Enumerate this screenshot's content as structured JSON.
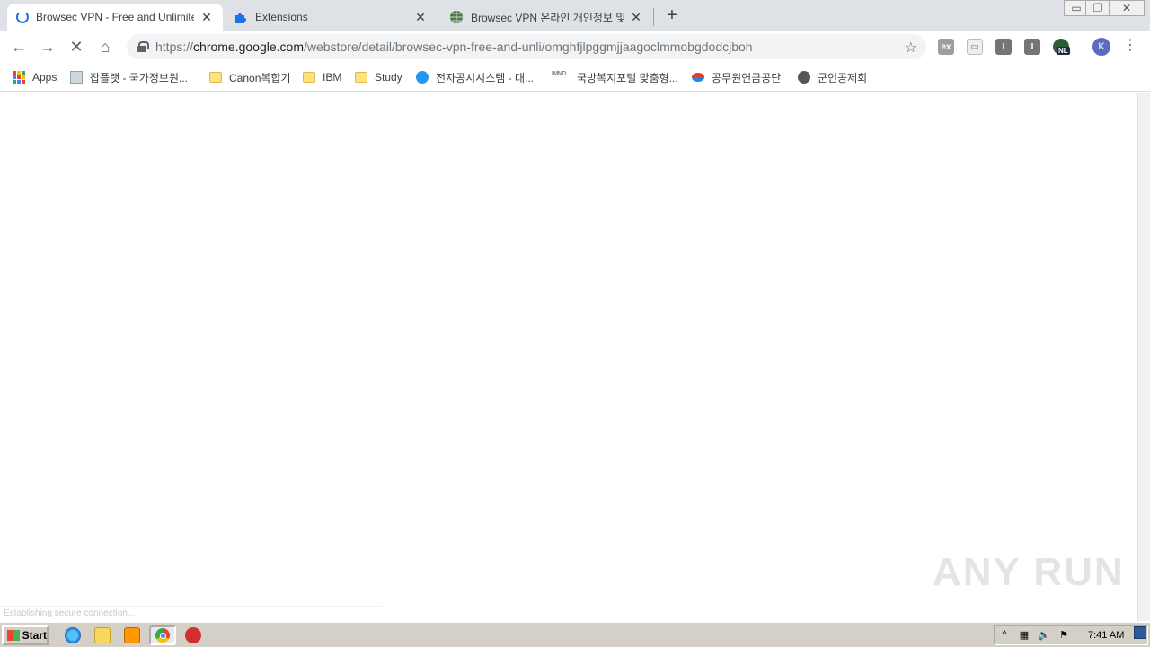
{
  "tabs": [
    {
      "title": "Browsec VPN - Free and Unlimited VPN",
      "active": true,
      "icon": "loading-spinner"
    },
    {
      "title": "Extensions",
      "active": false,
      "icon": "puzzle-icon"
    },
    {
      "title": "Browsec VPN 온라인 개인정보 및 보안",
      "active": false,
      "icon": "globe-icon"
    }
  ],
  "newtab_label": "+",
  "window_controls": {
    "minimize": "▭",
    "restore": "❐",
    "close": "✕"
  },
  "nav": {
    "back": "←",
    "forward": "→",
    "stop": "✕",
    "home": "⌂"
  },
  "omnibox": {
    "url_prefix": "https://",
    "url_host": "chrome.google.com",
    "url_path": "/webstore/detail/browsec-vpn-free-and-unli/omghfjlpggmjjaagoclmmobgdodcjboh"
  },
  "star": "☆",
  "extensions": [
    {
      "label": "ex"
    },
    {
      "label": "▭"
    },
    {
      "label": "I"
    },
    {
      "label": "I"
    },
    {
      "label": "NL"
    }
  ],
  "avatar_letter": "K",
  "menu_glyph": "⋮",
  "bookmarks": [
    {
      "label": "Apps",
      "icon": "apps-grid-icon"
    },
    {
      "label": "잡플랫 - 국가정보원...",
      "icon": "document-icon"
    },
    {
      "label": "Canon복합기",
      "icon": "folder-icon"
    },
    {
      "label": "IBM",
      "icon": "folder-icon"
    },
    {
      "label": "Study",
      "icon": "folder-icon"
    },
    {
      "label": "전자공시시스템 - 대...",
      "icon": "swirl-icon"
    },
    {
      "label": "국방복지포털 맞춤형...",
      "icon": "mnd-icon"
    },
    {
      "label": "공무원연금공단",
      "icon": "gov-icon"
    },
    {
      "label": "군인공제회",
      "icon": "globe-icon"
    }
  ],
  "mnd_text": "IMND",
  "status_text": "Establishing secure connection...",
  "watermark": "ANY RUN",
  "taskbar": {
    "start_label": "Start",
    "clock": "7:41 AM",
    "tray_icons": [
      "^",
      "▦",
      "🔈",
      "⚑"
    ]
  }
}
